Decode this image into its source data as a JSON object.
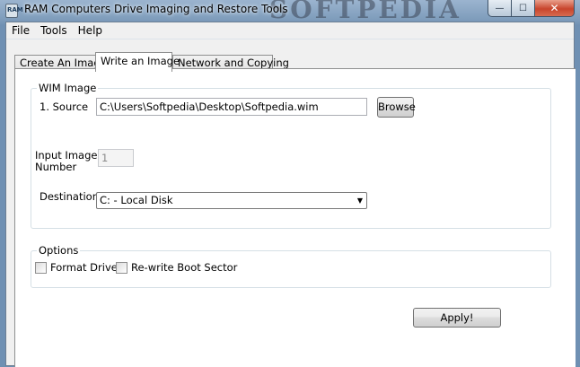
{
  "window": {
    "title": "RAM Computers Drive Imaging and Restore Tools",
    "icon_label": "RAM",
    "watermark": "SOFTPEDIA",
    "buttons": {
      "minimize": "—",
      "maximize": "☐",
      "close": "✕"
    }
  },
  "menu": {
    "items": [
      "File",
      "Tools",
      "Help"
    ]
  },
  "tabs": {
    "items": [
      "Create An Image",
      "Write an Image",
      "Network and Copying"
    ],
    "active": "Write an Image"
  },
  "wim_group": {
    "title": "WIM Image",
    "source_label": "1. Source",
    "source_value": "C:\\Users\\Softpedia\\Desktop\\Softpedia.wim",
    "browse_label": "Browse",
    "input_image_label_line1": "Input Image",
    "input_image_label_line2": "Number",
    "input_image_value": "1",
    "destination_label": "Destination",
    "destination_value": "C: - Local Disk"
  },
  "options_group": {
    "title": "Options",
    "format_drive_label": "Format Drive",
    "format_drive_checked": false,
    "rewrite_boot_label": "Re-write Boot Sector",
    "rewrite_boot_checked": false
  },
  "apply_label": "Apply!"
}
